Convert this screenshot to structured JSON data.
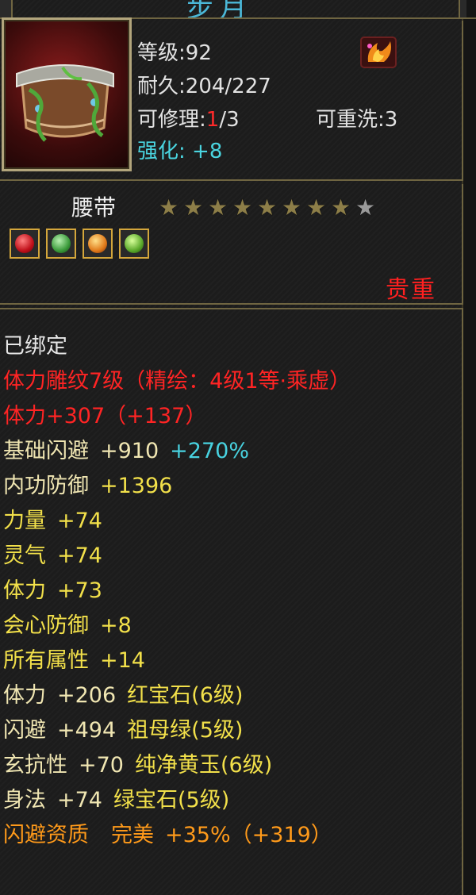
{
  "window": {
    "title": "步月"
  },
  "header": {
    "level_label": "等级",
    "level_value": "92",
    "durability_label": "耐久",
    "durability_value": "204/227",
    "repair_label": "可修理",
    "repair_used": "1",
    "repair_total": "/3",
    "rewash_label": "可重洗",
    "rewash_value": "3",
    "enhance_label": "强化:",
    "enhance_value": "+8",
    "badge_icon": "flame-wing-icon",
    "item_icon": "belt-icon"
  },
  "item": {
    "name": "腰带",
    "stars_filled": 8,
    "stars_total": 9,
    "quality": "贵重",
    "gems": [
      {
        "icon": "ruby-gem-icon",
        "color": "#d8202a"
      },
      {
        "icon": "emerald-gem-icon",
        "color": "#3fa84a"
      },
      {
        "icon": "topaz-gem-icon",
        "color": "#e9a12a"
      },
      {
        "icon": "jade-gem-icon",
        "color": "#69c23a"
      }
    ]
  },
  "attributes": {
    "bound": "已绑定",
    "engrave": "体力雕纹7级（精绘：4级1等·乘虚）",
    "stamina_main": "体力+307",
    "stamina_bonus": "（+137）",
    "dodge_base_label": "基础闪避",
    "dodge_base_value": "+910",
    "dodge_base_pct": "+270%",
    "inner_def_label": "内功防御",
    "inner_def_value": "+1396",
    "strength_label": "力量",
    "strength_value": "+74",
    "spirit_label": "灵气",
    "spirit_value": "+74",
    "stamina_label": "体力",
    "stamina_value": "+73",
    "crit_def_label": "会心防御",
    "crit_def_value": "+8",
    "all_attr_label": "所有属性",
    "all_attr_value": "+14",
    "gem_rows": [
      {
        "stat": "体力",
        "value": "+206",
        "gem": "红宝石",
        "level": "(6级)"
      },
      {
        "stat": "闪避",
        "value": "+494",
        "gem": "祖母绿",
        "level": "(5级)"
      },
      {
        "stat": "玄抗性",
        "value": "+70",
        "gem": "纯净黄玉",
        "level": "(6级)"
      },
      {
        "stat": "身法",
        "value": "+74",
        "gem": "绿宝石",
        "level": "(5级)"
      }
    ],
    "aptitude_label": "闪避资质",
    "aptitude_grade": "完美",
    "aptitude_pct": "+35%",
    "aptitude_bonus": "（+319）"
  },
  "colors": {
    "border": "#6f6541",
    "red": "#ff2424",
    "yellow": "#f2e04a",
    "cyan": "#48d2e0",
    "orange": "#ff9a1a"
  }
}
